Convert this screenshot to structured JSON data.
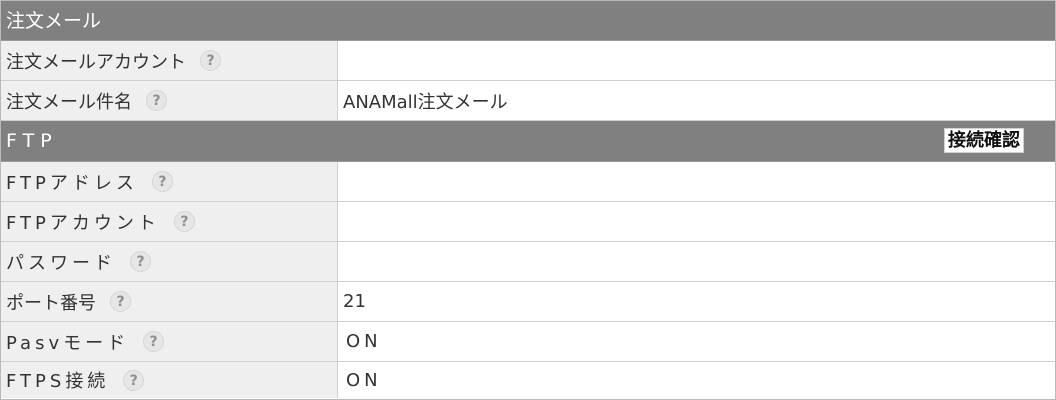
{
  "mail_section": {
    "title": "注文メール",
    "rows": [
      {
        "label": "注文メールアカウント",
        "value": ""
      },
      {
        "label": "注文メール件名",
        "value": "ANAMall注文メール"
      }
    ]
  },
  "ftp_section": {
    "title": "FTP",
    "connect_button": "接続確認",
    "rows": [
      {
        "label": "FTPアドレス",
        "value": ""
      },
      {
        "label": "FTPアカウント",
        "value": ""
      },
      {
        "label": "パスワード",
        "value": ""
      },
      {
        "label": "ポート番号",
        "value": "21"
      },
      {
        "label": "Pasvモード",
        "value": "ON"
      },
      {
        "label": "FTPS接続",
        "value": "ON"
      }
    ]
  },
  "help_icon_glyph": "?"
}
